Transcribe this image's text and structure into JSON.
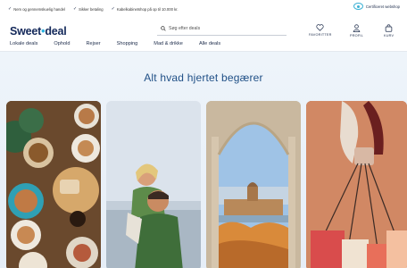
{
  "topbar": {
    "usps": [
      "Nem og gennemskuelig handel",
      "Sikker betaling",
      "Kabelkabinetshop på op til 10.000 kr."
    ],
    "certified": "Certificeret webshop"
  },
  "header": {
    "logo_part1": "Sweet",
    "logo_dash": "•",
    "logo_part2": "deal",
    "search_placeholder": "Søg efter deals",
    "nav": [
      "Lokale deals",
      "Ophold",
      "Rejser",
      "Shopping",
      "Mad & drikke",
      "Alle deals"
    ],
    "actions": {
      "favorites": "FAVORITTER",
      "profile": "PROFIL",
      "cart": "KURV"
    }
  },
  "hero": {
    "title": "Alt hvad hjertet begærer"
  },
  "colors": {
    "brand": "#13285a",
    "accent": "#2db3e0",
    "hero_bg": "#eef4fa"
  }
}
